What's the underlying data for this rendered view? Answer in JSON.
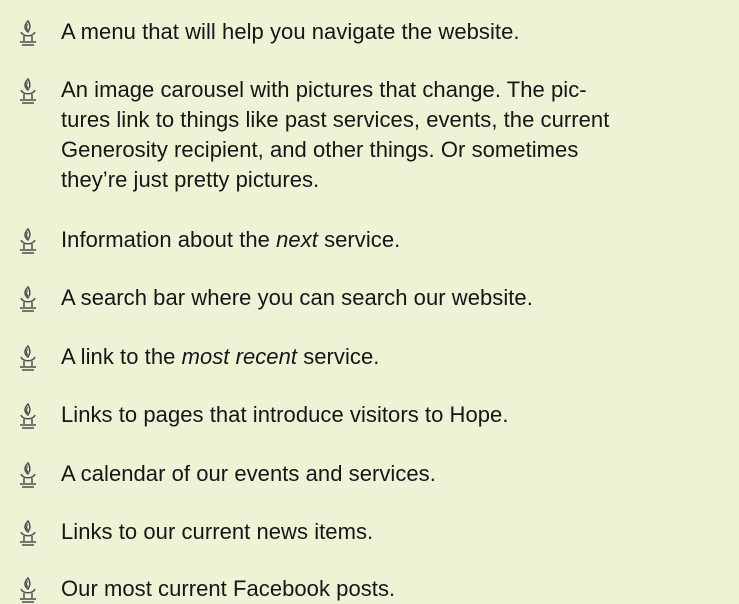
{
  "bullet_icon": "chalice-flame-icon",
  "colors": {
    "background": "#EEF3D5",
    "text": "#161616",
    "icon": "#4D4D4D"
  },
  "items": [
    {
      "text": "A menu that will help you navigate the website."
    },
    {
      "lines": [
        "An image carousel with pictures that change. The pic-",
        "tures link to things like past services, events, the current",
        "Generosity recipient, and other things. Or sometimes",
        "they’re just pretty pictures."
      ]
    },
    {
      "before": "Information about the ",
      "emphasis": "next",
      "after": " service."
    },
    {
      "text": "A search bar where you can search our website."
    },
    {
      "before": "A link to the ",
      "emphasis": "most recent",
      "after": " service."
    },
    {
      "text": "Links to pages that introduce visitors to Hope."
    },
    {
      "text": "A calendar of our events and services."
    },
    {
      "text": "Links to our current news items."
    },
    {
      "text": "Our most current Facebook posts."
    }
  ]
}
